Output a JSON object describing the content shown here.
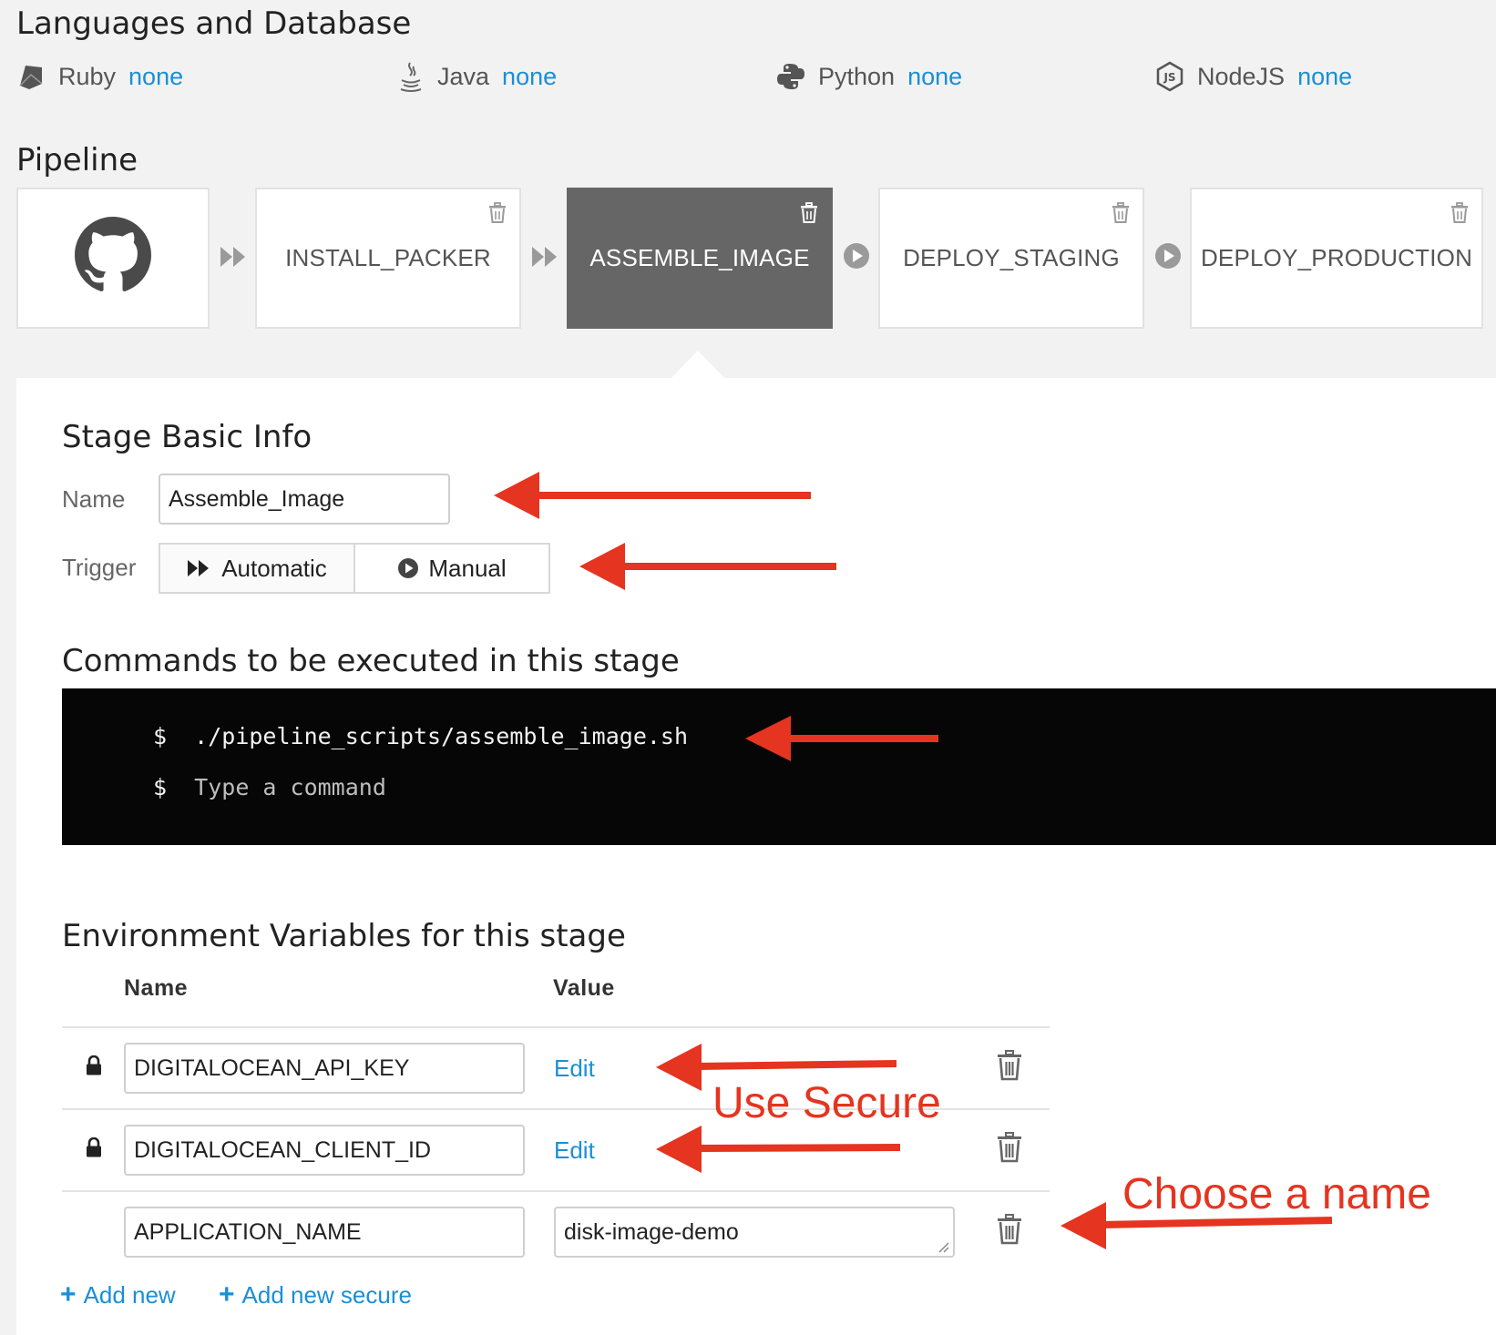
{
  "languages": {
    "title": "Languages and Database",
    "items": [
      {
        "icon": "ruby-icon",
        "name": "Ruby",
        "value": "none"
      },
      {
        "icon": "java-icon",
        "name": "Java",
        "value": "none"
      },
      {
        "icon": "python-icon",
        "name": "Python",
        "value": "none"
      },
      {
        "icon": "nodejs-icon",
        "name": "NodeJS",
        "value": "none"
      }
    ]
  },
  "pipeline": {
    "title": "Pipeline",
    "source_icon": "github-icon",
    "stages": [
      {
        "label": "INSTALL_PACKER",
        "trigger": "automatic"
      },
      {
        "label": "ASSEMBLE_IMAGE",
        "trigger": "automatic",
        "active": true
      },
      {
        "label": "DEPLOY_STAGING",
        "trigger": "manual"
      },
      {
        "label": "DEPLOY_PRODUCTION",
        "trigger": "manual"
      }
    ]
  },
  "stage_info": {
    "title": "Stage Basic Info",
    "name_label": "Name",
    "name_value": "Assemble_Image",
    "trigger_label": "Trigger",
    "trigger_automatic": "Automatic",
    "trigger_manual": "Manual",
    "trigger_selected": "Automatic"
  },
  "commands": {
    "title": "Commands to be executed in this stage",
    "prompt": "$",
    "lines": [
      "./pipeline_scripts/assemble_image.sh"
    ],
    "placeholder": "Type a command"
  },
  "env": {
    "title": "Environment Variables for this stage",
    "col_name": "Name",
    "col_value": "Value",
    "rows": [
      {
        "name": "DIGITALOCEAN_API_KEY",
        "secure": true,
        "value_action": "Edit"
      },
      {
        "name": "DIGITALOCEAN_CLIENT_ID",
        "secure": true,
        "value_action": "Edit"
      },
      {
        "name": "APPLICATION_NAME",
        "secure": false,
        "value": "disk-image-demo"
      }
    ],
    "add_new": "Add new",
    "add_new_secure": "Add new secure"
  },
  "annotations": {
    "use_secure": "Use Secure",
    "choose_name": "Choose a name",
    "arrow_color": "#e53420"
  },
  "colors": {
    "link": "#1a8fd6",
    "active_stage": "#666666",
    "terminal_bg": "#060606"
  }
}
